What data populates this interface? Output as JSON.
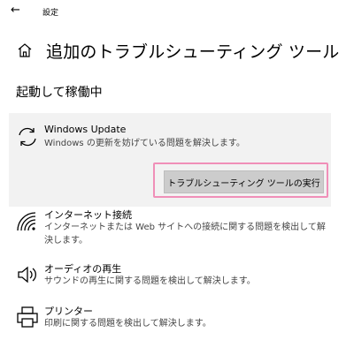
{
  "topbar": {
    "back_glyph": "←",
    "app_title": "設定"
  },
  "page": {
    "title": "追加のトラブルシューティング ツール",
    "icon": "home-icon"
  },
  "section": {
    "title": "起動して稼働中"
  },
  "items": [
    {
      "name": "Windows Update",
      "description": "Windows の更新を妨げている問題を解決します。",
      "icon": "sync-icon",
      "selected": true
    },
    {
      "name": "インターネット接続",
      "description": "インターネットまたは Web サイトへの接続に関する問題を検出して解決します。",
      "icon": "wifi-icon"
    },
    {
      "name": "オーディオの再生",
      "description": "サウンドの再生に関する問題を検出して解決します。",
      "icon": "speaker-icon"
    },
    {
      "name": "プリンター",
      "description": "印刷に関する問題を検出して解決します。",
      "icon": "printer-icon"
    }
  ],
  "run_button": {
    "label": "トラブルシューティング ツールの実行"
  },
  "colors": {
    "selected_bg": "#f2f2f2",
    "button_bg": "#cccccc",
    "highlight": "#f08fb8"
  }
}
